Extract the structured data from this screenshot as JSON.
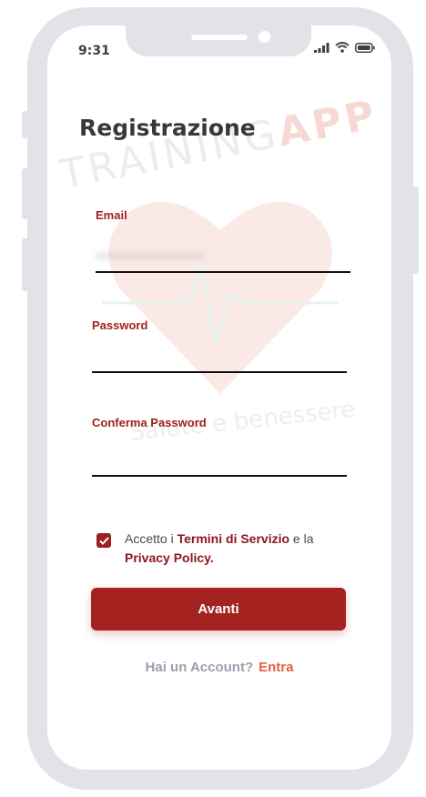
{
  "status_bar": {
    "time": "9:31"
  },
  "watermark": {
    "brand_text": "TRAINING",
    "brand_accent": "APP",
    "tagline": "Salute e benessere"
  },
  "page": {
    "title": "Registrazione"
  },
  "form": {
    "email": {
      "label": "Email",
      "value": "xxxxxxxxxxxxxxxxx"
    },
    "password": {
      "label": "Password",
      "value": ""
    },
    "confirm_password": {
      "label": "Conferma Password",
      "value": ""
    }
  },
  "terms": {
    "checked": true,
    "prefix": "Accetto i",
    "terms_link": "Termini di Servizio",
    "middle": "e la",
    "privacy_link": "Privacy Policy."
  },
  "actions": {
    "submit_label": "Avanti"
  },
  "footer": {
    "question": "Hai un Account?",
    "login_link": "Entra"
  },
  "colors": {
    "primary": "#a42220",
    "link": "#e4613f",
    "frame": "#e1e3e8"
  }
}
